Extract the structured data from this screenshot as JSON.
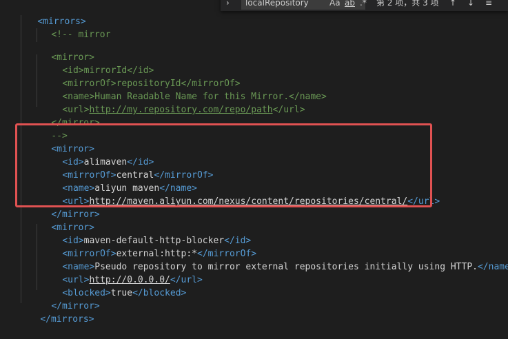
{
  "find_widget": {
    "query": "localRepository",
    "match_case_label": "Aa",
    "whole_word_label": "ab",
    "match_count": "第 2 项，共 3 项",
    "prev_icon": "arrow-up-icon",
    "next_icon": "arrow-down-icon",
    "selection_icon": "find-in-selection-icon"
  },
  "code": {
    "mirrors_open": "<mirrors>",
    "comment_open": "<!-- mirror",
    "m1_open": "<mirror>",
    "m1_id_open": "<id>",
    "m1_id_val": "mirrorId",
    "m1_id_close": "</id>",
    "m1_of_open": "<mirrorOf>",
    "m1_of_val": "repositoryId",
    "m1_of_close": "</mirrorOf>",
    "m1_name_open": "<name>",
    "m1_name_val": "Human Readable Name for this Mirror.",
    "m1_name_close": "</name>",
    "m1_url_open": "<url>",
    "m1_url_val": "http://my.repository.com/repo/path",
    "m1_url_close": "</url>",
    "m1_close": "</mirror>",
    "comment_close": "-->",
    "m2_open": "<mirror>",
    "m2_id_open": "<id>",
    "m2_id_val": "alimaven",
    "m2_id_close": "</id>",
    "m2_of_open": "<mirrorOf>",
    "m2_of_val": "central",
    "m2_of_close": "</mirrorOf>",
    "m2_name_open": "<name>",
    "m2_name_val": "aliyun maven",
    "m2_name_close": "</name>",
    "m2_url_open": "<url>",
    "m2_url_val": "http://maven.aliyun.com/nexus/content/repositories/central/",
    "m2_url_close": "</url>",
    "m2_close": "</mirror>",
    "m3_open": "<mirror>",
    "m3_id_open": "<id>",
    "m3_id_val": "maven-default-http-blocker",
    "m3_id_close": "</id>",
    "m3_of_open": "<mirrorOf>",
    "m3_of_val": "external:http:*",
    "m3_of_close": "</mirrorOf>",
    "m3_name_open": "<name>",
    "m3_name_val": "Pseudo repository to mirror external repositories initially using HTTP.",
    "m3_name_close": "</name>",
    "m3_url_open": "<url>",
    "m3_url_val": "http://0.0.0.0/",
    "m3_url_close": "</url>",
    "m3_blocked_open": "<blocked>",
    "m3_blocked_val": "true",
    "m3_blocked_close": "</blocked>",
    "m3_close": "</mirror>",
    "mirrors_close": "</mirrors>"
  },
  "colors": {
    "background": "#1e1e1e",
    "tag": "#569cd6",
    "text": "#d4d4d4",
    "comment": "#6a9955",
    "highlight_border": "#e05252"
  }
}
